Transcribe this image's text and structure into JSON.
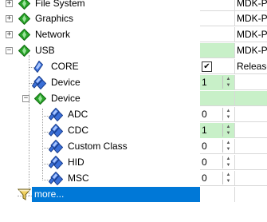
{
  "tree": {
    "nodes": [
      {
        "label": "File System",
        "icon": "green-diamond",
        "state": "collapsed"
      },
      {
        "label": "Graphics",
        "icon": "green-diamond",
        "state": "collapsed"
      },
      {
        "label": "Network",
        "icon": "green-diamond",
        "state": "collapsed"
      },
      {
        "label": "USB",
        "icon": "green-diamond",
        "state": "expanded"
      },
      {
        "label": "CORE",
        "icon": "blue-diamond"
      },
      {
        "label": "Device",
        "icon": "blue-gems"
      },
      {
        "label": "Device",
        "icon": "green-diamond",
        "state": "expanded"
      },
      {
        "label": "ADC",
        "icon": "blue-gems"
      },
      {
        "label": "CDC",
        "icon": "blue-gems"
      },
      {
        "label": "Custom Class",
        "icon": "blue-gems"
      },
      {
        "label": "HID",
        "icon": "blue-gems"
      },
      {
        "label": "MSC",
        "icon": "blue-gems"
      },
      {
        "label": "more...",
        "icon": "funnel",
        "selected": true
      }
    ]
  },
  "grid": {
    "rows": [
      {
        "c2": "MDK-P"
      },
      {
        "c2": "MDK-P"
      },
      {
        "c2": "MDK-P"
      },
      {
        "c2": "MDK-P",
        "green": true
      },
      {
        "checkbox": true,
        "checked": true,
        "c2": "Release"
      },
      {
        "value": "1",
        "spinner": true,
        "green": true
      },
      {
        "green": true
      },
      {
        "value": "0",
        "spinner": true
      },
      {
        "value": "1",
        "spinner": true,
        "green": true
      },
      {
        "value": "0",
        "spinner": true
      },
      {
        "value": "0",
        "spinner": true
      },
      {
        "value": "0",
        "spinner": true
      },
      {}
    ]
  },
  "colors": {
    "selection": "#0078d7",
    "green_cell": "#c8f0c8"
  }
}
